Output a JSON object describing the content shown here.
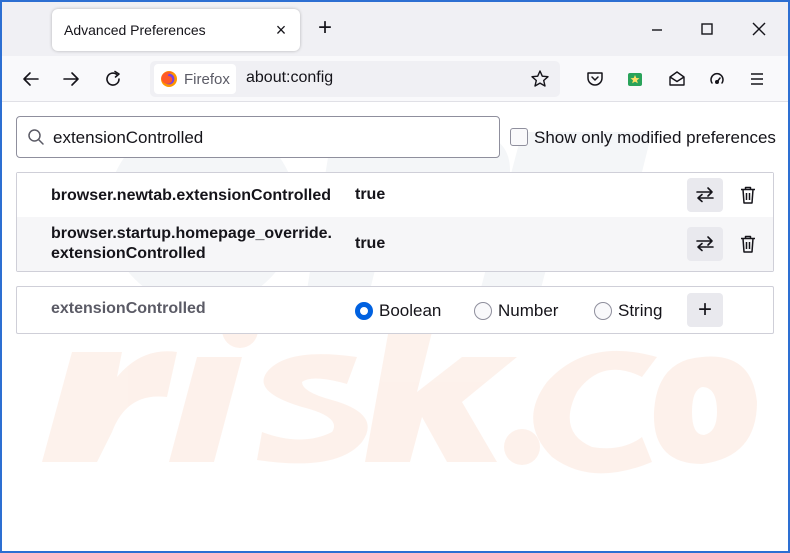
{
  "tab": {
    "title": "Advanced Preferences",
    "close_glyph": "×"
  },
  "new_tab_glyph": "+",
  "urlbar": {
    "identity_label": "Firefox",
    "url": "about:config"
  },
  "search": {
    "value": "extensionControlled"
  },
  "show_modified_label": "Show only modified preferences",
  "show_modified_checked": false,
  "preferences": [
    {
      "name": "browser.newtab.extensionControlled",
      "value": "true"
    },
    {
      "name_line1": "browser.startup.homepage_override.",
      "name_line2": "extensionControlled",
      "value": "true"
    }
  ],
  "add_row": {
    "name": "extensionControlled",
    "types": [
      "Boolean",
      "Number",
      "String"
    ],
    "selected_type": "Boolean",
    "add_glyph": "+"
  },
  "colors": {
    "accent": "#0061e0",
    "frame": "#2d6fd2",
    "tabstrip": "#f0f0f4",
    "watermark": "#f2a37a"
  },
  "icons": [
    "firefox-logo-icon",
    "back-arrow-icon",
    "forward-arrow-icon",
    "reload-icon",
    "star-icon",
    "pocket-icon",
    "extension-icon",
    "mail-icon",
    "sync-icon",
    "hamburger-menu-icon",
    "search-icon",
    "toggle-arrows-icon",
    "trash-icon",
    "minimize-icon",
    "maximize-icon",
    "close-icon"
  ]
}
